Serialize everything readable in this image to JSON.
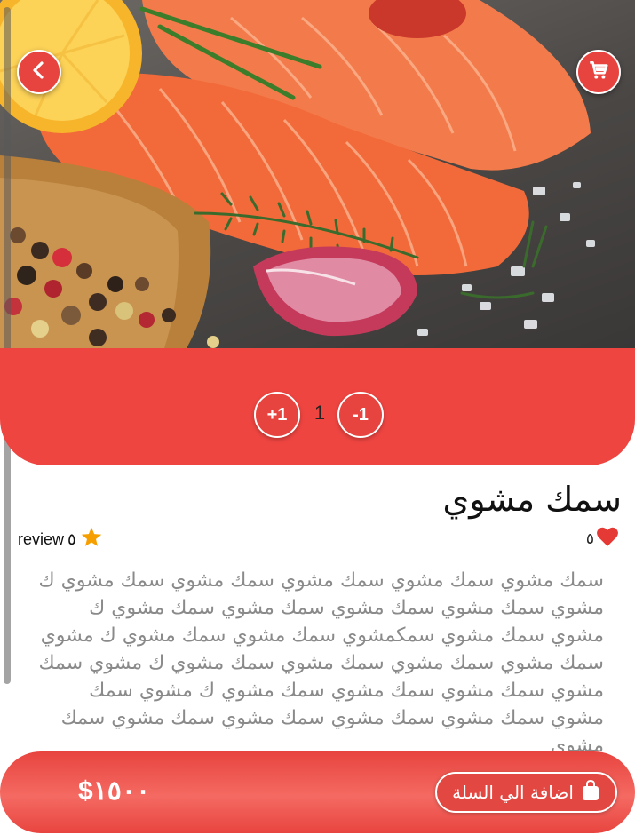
{
  "product": {
    "title": "سمك مشوي",
    "likes": "٥",
    "rating": "٥",
    "review_label": "review",
    "description": "سمك مشوي سمك مشوي سمك مشوي سمك مشوي سمك مشوي ك مشوي سمك مشوي سمك مشوي سمك مشوي سمك مشوي ك مشوي سمك مشوي سمكمشوي سمك مشوي سمك مشوي ك مشوي سمك مشوي سمك مشوي سمك مشوي سمك مشوي ك مشوي سمك مشوي سمك مشوي سمك مشوي سمك مشوي ك مشوي سمك مشوي سمك مشوي سمك مشوي سمك مشوي سمك مشوي سمك مشوي"
  },
  "quantity": {
    "plus_label": "+1",
    "minus_label": "-1",
    "value": "1"
  },
  "bottom_bar": {
    "price": "$١٥٠٠",
    "add_to_cart_label": "اضافة الي السلة"
  },
  "icons": {
    "back": "chevron-left-icon",
    "cart": "shopping-cart-icon",
    "like": "heart-icon",
    "rating": "star-icon",
    "bag": "shopping-bag-icon"
  },
  "colors": {
    "accent": "#ef4541",
    "star": "#f5a000",
    "heart": "#e53935",
    "description_text": "#8a8a8a"
  }
}
